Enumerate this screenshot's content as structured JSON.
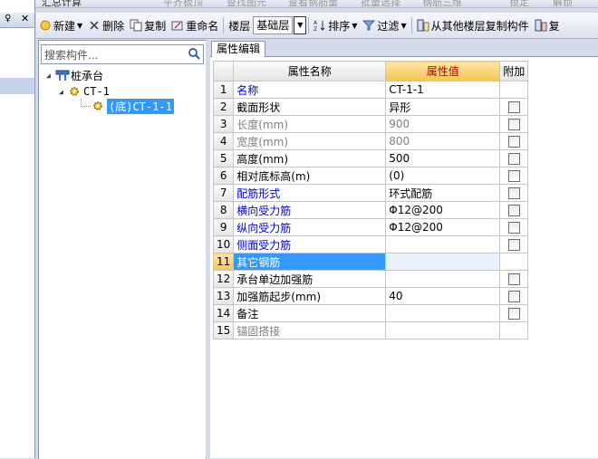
{
  "top_strip": [
    "汇总计算",
    "平齐板顶",
    "查找图元",
    "查看钢筋量",
    "批量选择",
    "钢筋三维",
    "锁定",
    "解锁"
  ],
  "left_panel": {
    "pin": "♀",
    "close": "✕"
  },
  "toolbar": {
    "new": "新建",
    "delete": "删除",
    "copy": "复制",
    "rename": "重命名",
    "floor_label": "楼层",
    "floor_value": "基础层",
    "sort": "排序",
    "filter": "过滤",
    "copy_from_floor": "从其他楼层复制构件",
    "more": "复"
  },
  "search": {
    "placeholder": "搜索构件..."
  },
  "tree": {
    "root": "桩承台",
    "child": "CT-1",
    "leaf": "(底)CT-1-1"
  },
  "tab": {
    "label": "属性编辑"
  },
  "grid": {
    "headers": {
      "num": "",
      "name": "属性名称",
      "value": "属性值",
      "extra": "附加"
    },
    "rows": [
      {
        "num": "1",
        "name": "名称",
        "value": "CT-1-1"
      },
      {
        "num": "2",
        "name": "截面形状",
        "value": "异形"
      },
      {
        "num": "3",
        "name": "长度(mm)",
        "value": "900"
      },
      {
        "num": "4",
        "name": "宽度(mm)",
        "value": "800"
      },
      {
        "num": "5",
        "name": "高度(mm)",
        "value": "500"
      },
      {
        "num": "6",
        "name": "相对底标高(m)",
        "value": "(0)"
      },
      {
        "num": "7",
        "name": "配筋形式",
        "value": "环式配筋"
      },
      {
        "num": "8",
        "name": "横向受力筋",
        "value": "Φ12@200"
      },
      {
        "num": "9",
        "name": "纵向受力筋",
        "value": "Φ12@200"
      },
      {
        "num": "10",
        "name": "侧面受力筋",
        "value": ""
      },
      {
        "num": "11",
        "name": "其它钢筋",
        "value": ""
      },
      {
        "num": "12",
        "name": "承台单边加强筋",
        "value": ""
      },
      {
        "num": "13",
        "name": "加强筋起步(mm)",
        "value": "40"
      },
      {
        "num": "14",
        "name": "备注",
        "value": ""
      },
      {
        "num": "15",
        "name": "锚固搭接",
        "value": ""
      }
    ]
  },
  "colors": {
    "selection": "#3399ff",
    "value_header": "#f6c553",
    "blue_text": "#0000cc",
    "gray_text": "#808080"
  }
}
